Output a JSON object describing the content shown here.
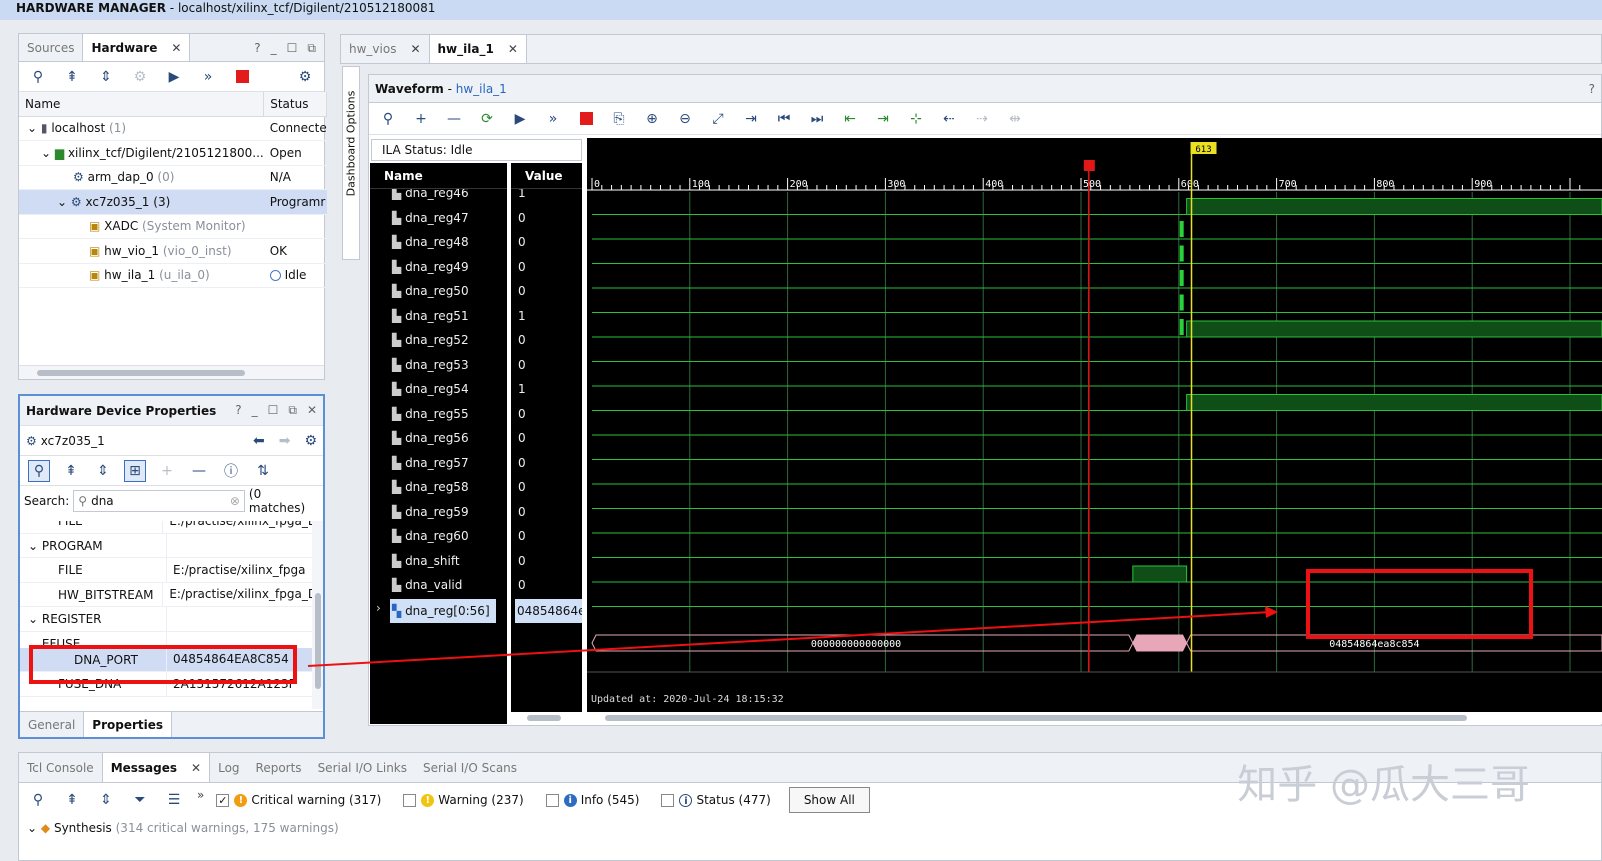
{
  "window": {
    "app": "HARDWARE MANAGER",
    "path": " - localhost/xilinx_tcf/Digilent/210512180081"
  },
  "hw_panel": {
    "tabs": [
      {
        "label": "Sources"
      },
      {
        "label": "Hardware"
      }
    ],
    "columns": [
      "Name",
      "Status"
    ],
    "rows": [
      {
        "name": "localhost",
        "suffix": " (1)",
        "status": "Connecte"
      },
      {
        "name": "xilinx_tcf/Digilent/2105121800...",
        "suffix": "",
        "status": "Open"
      },
      {
        "name": "arm_dap_0",
        "suffix": " (0)",
        "status": "N/A"
      },
      {
        "name": "xc7z035_1",
        "suffix": " (3)",
        "status": "Programr"
      },
      {
        "name": "XADC",
        "suffix": " (System Monitor)",
        "status": ""
      },
      {
        "name": "hw_vio_1",
        "suffix": " (vio_0_inst)",
        "status": "OK"
      },
      {
        "name": "hw_ila_1",
        "suffix": " (u_ila_0)",
        "status": "Idle"
      }
    ]
  },
  "props_panel": {
    "title": "Hardware Device Properties",
    "device": "xc7z035_1",
    "search_label": "Search:",
    "search_value": "dna",
    "matches": "(0 matches)",
    "rows": [
      {
        "name": "FILE",
        "value": "E:/practise/xilinx_fpga_D",
        "kind": "clip"
      },
      {
        "name": "PROGRAM",
        "value": "",
        "kind": "section"
      },
      {
        "name": "FILE",
        "value": "E:/practise/xilinx_fpga",
        "kind": "item"
      },
      {
        "name": "HW_BITSTREAM",
        "value": "E:/practise/xilinx_fpga_D",
        "kind": "item"
      },
      {
        "name": "REGISTER",
        "value": "",
        "kind": "section"
      },
      {
        "name": "EFUSE",
        "value": "",
        "kind": "clipsection"
      },
      {
        "name": "DNA_PORT",
        "value": "04854864EA8C854",
        "kind": "sel"
      },
      {
        "name": "FUSE_DNA",
        "value": "2A131572612A123F",
        "kind": "item"
      }
    ],
    "bottom_tabs": [
      "General",
      "Properties"
    ]
  },
  "editor_tabs": [
    {
      "label": "hw_vios"
    },
    {
      "label": "hw_ila_1"
    }
  ],
  "dashboard_label": "Dashboard Options",
  "waveform": {
    "title": "Waveform",
    "name": "hw_ila_1",
    "status": "ILA Status:  Idle",
    "name_header": "Name",
    "value_header": "Value",
    "cursor_label": "613",
    "ticks": [
      "0",
      "100",
      "200",
      "300",
      "400",
      "500",
      "600",
      "700",
      "800",
      "900"
    ],
    "signals": [
      {
        "name": "dna_reg46",
        "value": "1",
        "high_from": 608
      },
      {
        "name": "dna_reg47",
        "value": "0"
      },
      {
        "name": "dna_reg48",
        "value": "0"
      },
      {
        "name": "dna_reg49",
        "value": "0"
      },
      {
        "name": "dna_reg50",
        "value": "0"
      },
      {
        "name": "dna_reg51",
        "value": "1",
        "high_from": 608
      },
      {
        "name": "dna_reg52",
        "value": "0"
      },
      {
        "name": "dna_reg53",
        "value": "0"
      },
      {
        "name": "dna_reg54",
        "value": "1",
        "high_from": 608
      },
      {
        "name": "dna_reg55",
        "value": "0"
      },
      {
        "name": "dna_reg56",
        "value": "0"
      },
      {
        "name": "dna_reg57",
        "value": "0"
      },
      {
        "name": "dna_reg58",
        "value": "0"
      },
      {
        "name": "dna_reg59",
        "value": "0"
      },
      {
        "name": "dna_reg60",
        "value": "0"
      },
      {
        "name": "dna_shift",
        "value": "0",
        "high_from": 553,
        "high_to": 608
      },
      {
        "name": "dna_valid",
        "value": "0"
      }
    ],
    "bus": {
      "name": "dna_reg[0:56]",
      "value": "04854864ea8c854",
      "left_text": "000000000000000",
      "right_text": "04854864ea8c854"
    },
    "updated": "Updated at: 2020-Jul-24 18:15:32"
  },
  "bottom": {
    "tabs": [
      "Tcl Console",
      "Messages",
      "Log",
      "Reports",
      "Serial I/O Links",
      "Serial I/O Scans"
    ],
    "filters": [
      {
        "label": "Critical warning (317)",
        "checked": true,
        "color": "#f39c12"
      },
      {
        "label": "Warning (237)",
        "checked": false,
        "color": "#f1c40f"
      },
      {
        "label": "Info (545)",
        "checked": false,
        "color": "#2d6cc0"
      },
      {
        "label": "Status (477)",
        "checked": false,
        "color": "#ffffff"
      }
    ],
    "show_all": "Show All",
    "synth_label": "Synthesis",
    "synth_detail": " (314 critical warnings, 175 warnings)"
  },
  "watermark": "知乎 @瓜大三哥"
}
